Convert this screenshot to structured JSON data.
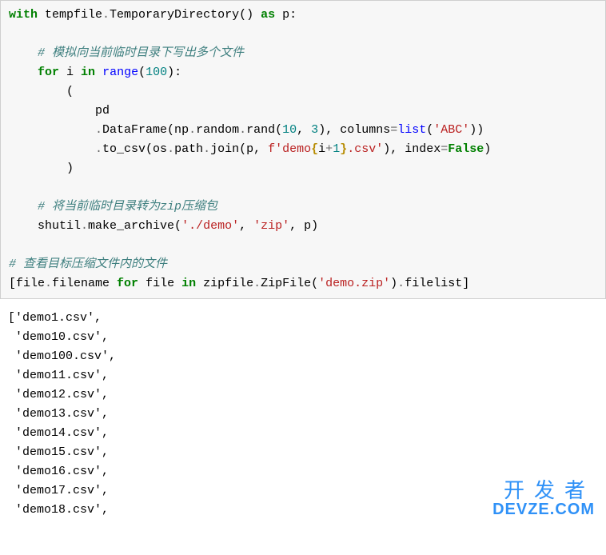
{
  "code_lines": [
    [
      {
        "cls": "tok-kw",
        "t": "with"
      },
      {
        "cls": "",
        "t": " tempfile"
      },
      {
        "cls": "tok-op",
        "t": "."
      },
      {
        "cls": "",
        "t": "TemporaryDirectory() "
      },
      {
        "cls": "tok-kw",
        "t": "as"
      },
      {
        "cls": "",
        "t": " p:"
      }
    ],
    [],
    [
      {
        "cls": "",
        "t": "    "
      },
      {
        "cls": "tok-cmt",
        "t": "# 模拟向当前临时目录下写出多个文件"
      }
    ],
    [
      {
        "cls": "",
        "t": "    "
      },
      {
        "cls": "tok-kw",
        "t": "for"
      },
      {
        "cls": "",
        "t": " i "
      },
      {
        "cls": "tok-kw",
        "t": "in"
      },
      {
        "cls": "",
        "t": " "
      },
      {
        "cls": "tok-func",
        "t": "range"
      },
      {
        "cls": "",
        "t": "("
      },
      {
        "cls": "tok-num",
        "t": "100"
      },
      {
        "cls": "",
        "t": "):"
      }
    ],
    [
      {
        "cls": "",
        "t": "        ("
      }
    ],
    [
      {
        "cls": "",
        "t": "            pd"
      }
    ],
    [
      {
        "cls": "",
        "t": "            "
      },
      {
        "cls": "tok-op",
        "t": "."
      },
      {
        "cls": "",
        "t": "DataFrame(np"
      },
      {
        "cls": "tok-op",
        "t": "."
      },
      {
        "cls": "",
        "t": "random"
      },
      {
        "cls": "tok-op",
        "t": "."
      },
      {
        "cls": "",
        "t": "rand("
      },
      {
        "cls": "tok-num",
        "t": "10"
      },
      {
        "cls": "",
        "t": ", "
      },
      {
        "cls": "tok-num",
        "t": "3"
      },
      {
        "cls": "",
        "t": "), columns"
      },
      {
        "cls": "tok-op",
        "t": "="
      },
      {
        "cls": "tok-func",
        "t": "list"
      },
      {
        "cls": "",
        "t": "("
      },
      {
        "cls": "tok-str",
        "t": "'ABC'"
      },
      {
        "cls": "",
        "t": "))"
      }
    ],
    [
      {
        "cls": "",
        "t": "            "
      },
      {
        "cls": "tok-op",
        "t": "."
      },
      {
        "cls": "",
        "t": "to_csv(os"
      },
      {
        "cls": "tok-op",
        "t": "."
      },
      {
        "cls": "",
        "t": "path"
      },
      {
        "cls": "tok-op",
        "t": "."
      },
      {
        "cls": "",
        "t": "join(p, "
      },
      {
        "cls": "tok-fstr",
        "t": "f'demo"
      },
      {
        "cls": "tok-intp",
        "t": "{"
      },
      {
        "cls": "",
        "t": "i"
      },
      {
        "cls": "tok-op",
        "t": "+"
      },
      {
        "cls": "tok-num",
        "t": "1"
      },
      {
        "cls": "tok-intp",
        "t": "}"
      },
      {
        "cls": "tok-fstr",
        "t": ".csv'"
      },
      {
        "cls": "",
        "t": "), index"
      },
      {
        "cls": "tok-op",
        "t": "="
      },
      {
        "cls": "tok-kw",
        "t": "False"
      },
      {
        "cls": "",
        "t": ")"
      }
    ],
    [
      {
        "cls": "",
        "t": "        )"
      }
    ],
    [],
    [
      {
        "cls": "",
        "t": "    "
      },
      {
        "cls": "tok-cmt",
        "t": "# 将当前临时目录转为zip压缩包"
      }
    ],
    [
      {
        "cls": "",
        "t": "    shutil"
      },
      {
        "cls": "tok-op",
        "t": "."
      },
      {
        "cls": "",
        "t": "make_archive("
      },
      {
        "cls": "tok-str",
        "t": "'./demo'"
      },
      {
        "cls": "",
        "t": ", "
      },
      {
        "cls": "tok-str",
        "t": "'zip'"
      },
      {
        "cls": "",
        "t": ", p)"
      }
    ],
    [],
    [
      {
        "cls": "tok-cmt",
        "t": "# 查看目标压缩文件内的文件"
      }
    ],
    [
      {
        "cls": "",
        "t": "[file"
      },
      {
        "cls": "tok-op",
        "t": "."
      },
      {
        "cls": "",
        "t": "filename "
      },
      {
        "cls": "tok-kw",
        "t": "for"
      },
      {
        "cls": "",
        "t": " file "
      },
      {
        "cls": "tok-kw",
        "t": "in"
      },
      {
        "cls": "",
        "t": " zipfile"
      },
      {
        "cls": "tok-op",
        "t": "."
      },
      {
        "cls": "",
        "t": "ZipFile("
      },
      {
        "cls": "tok-str",
        "t": "'demo.zip'"
      },
      {
        "cls": "",
        "t": ")"
      },
      {
        "cls": "tok-op",
        "t": "."
      },
      {
        "cls": "",
        "t": "filelist]"
      }
    ]
  ],
  "output_lines": [
    "['demo1.csv',",
    " 'demo10.csv',",
    " 'demo100.csv',",
    " 'demo11.csv',",
    " 'demo12.csv',",
    " 'demo13.csv',",
    " 'demo14.csv',",
    " 'demo15.csv',",
    " 'demo16.csv',",
    " 'demo17.csv',",
    " 'demo18.csv',"
  ],
  "watermark": {
    "cn": "开发者",
    "en": "DEVZE.COM"
  }
}
